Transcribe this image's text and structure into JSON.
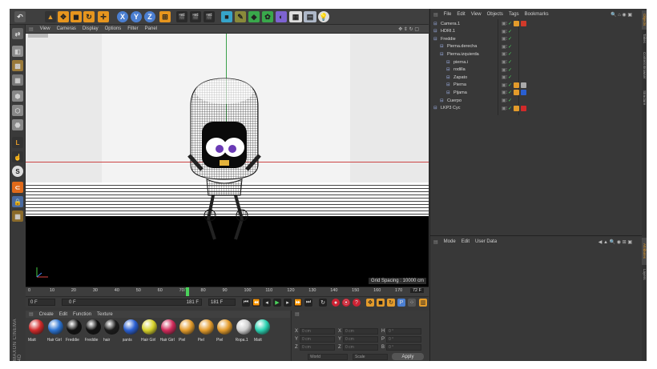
{
  "viewport": {
    "menu": [
      "View",
      "Cameras",
      "Display",
      "Options",
      "Filter",
      "Panel"
    ],
    "grid_spacing": "Grid Spacing : 10000 cm"
  },
  "timeline": {
    "ticks": [
      "0",
      "10",
      "20",
      "30",
      "40",
      "50",
      "60",
      "70",
      "72",
      "80",
      "90",
      "100",
      "110",
      "120",
      "130",
      "140",
      "150",
      "160",
      "170",
      "180"
    ],
    "current_frame_marker": "72 F",
    "start_frame": "0 F",
    "start_field": "0 F",
    "end_field_1": "181 F",
    "end_field_2": "181 F",
    "playhead_fraction": 0.4
  },
  "materials": {
    "menu": [
      "Create",
      "Edit",
      "Function",
      "Texture"
    ],
    "items": [
      {
        "label": "Matt",
        "color": "#d12a2a"
      },
      {
        "label": "Hair Girl",
        "color": "#2a72d1"
      },
      {
        "label": "Freddie",
        "color": "#111111"
      },
      {
        "label": "Freddie",
        "color": "#111111"
      },
      {
        "label": "hair",
        "color": "#1c1c1c"
      },
      {
        "label": "pants",
        "color": "#2a5fd1"
      },
      {
        "label": "Hair Girl",
        "color": "#d7d22a"
      },
      {
        "label": "Hair Girl",
        "color": "#d12a5a"
      },
      {
        "label": "Piel",
        "color": "#e39b2b"
      },
      {
        "label": "Piel",
        "color": "#e39b2b"
      },
      {
        "label": "Piel",
        "color": "#e39b2b"
      },
      {
        "label": "Ropa.1",
        "color": "#cfcfcf"
      },
      {
        "label": "Matt",
        "color": "#2ad1b0"
      }
    ]
  },
  "coordinates": {
    "rows": [
      {
        "a": "X",
        "av": "0 cm",
        "b": "X",
        "bv": "0 cm",
        "c": "H",
        "cv": "0 °"
      },
      {
        "a": "Y",
        "av": "0 cm",
        "b": "Y",
        "bv": "0 cm",
        "c": "P",
        "cv": "0 °"
      },
      {
        "a": "Z",
        "av": "0 cm",
        "b": "Z",
        "bv": "0 cm",
        "c": "B",
        "cv": "0 °"
      }
    ],
    "mode": "World",
    "scale": "Scale",
    "apply": "Apply"
  },
  "objects": {
    "menu": [
      "File",
      "Edit",
      "View",
      "Objects",
      "Tags",
      "Bookmarks"
    ],
    "items": [
      {
        "name": "Camera.1",
        "indent": 0
      },
      {
        "name": "HDRI.1",
        "indent": 0
      },
      {
        "name": "Freddie",
        "indent": 0
      },
      {
        "name": "Pierna.derecha",
        "indent": 1
      },
      {
        "name": "Pierna.izquierda",
        "indent": 1
      },
      {
        "name": "pierna.i",
        "indent": 2
      },
      {
        "name": "rodilla",
        "indent": 2
      },
      {
        "name": "Zapato",
        "indent": 2
      },
      {
        "name": "Pierna",
        "indent": 2
      },
      {
        "name": "Pijama",
        "indent": 2
      },
      {
        "name": "Cuerpo",
        "indent": 1
      },
      {
        "name": "LKP3 Cyc",
        "indent": 0
      }
    ]
  },
  "attributes": {
    "menu": [
      "Mode",
      "Edit",
      "User Data"
    ]
  },
  "right_tabs": [
    "Objects",
    "Takes",
    "Content Browser",
    "Structure",
    "Attributes",
    "Layers"
  ],
  "brand": "MAXON CINEMA 4D"
}
